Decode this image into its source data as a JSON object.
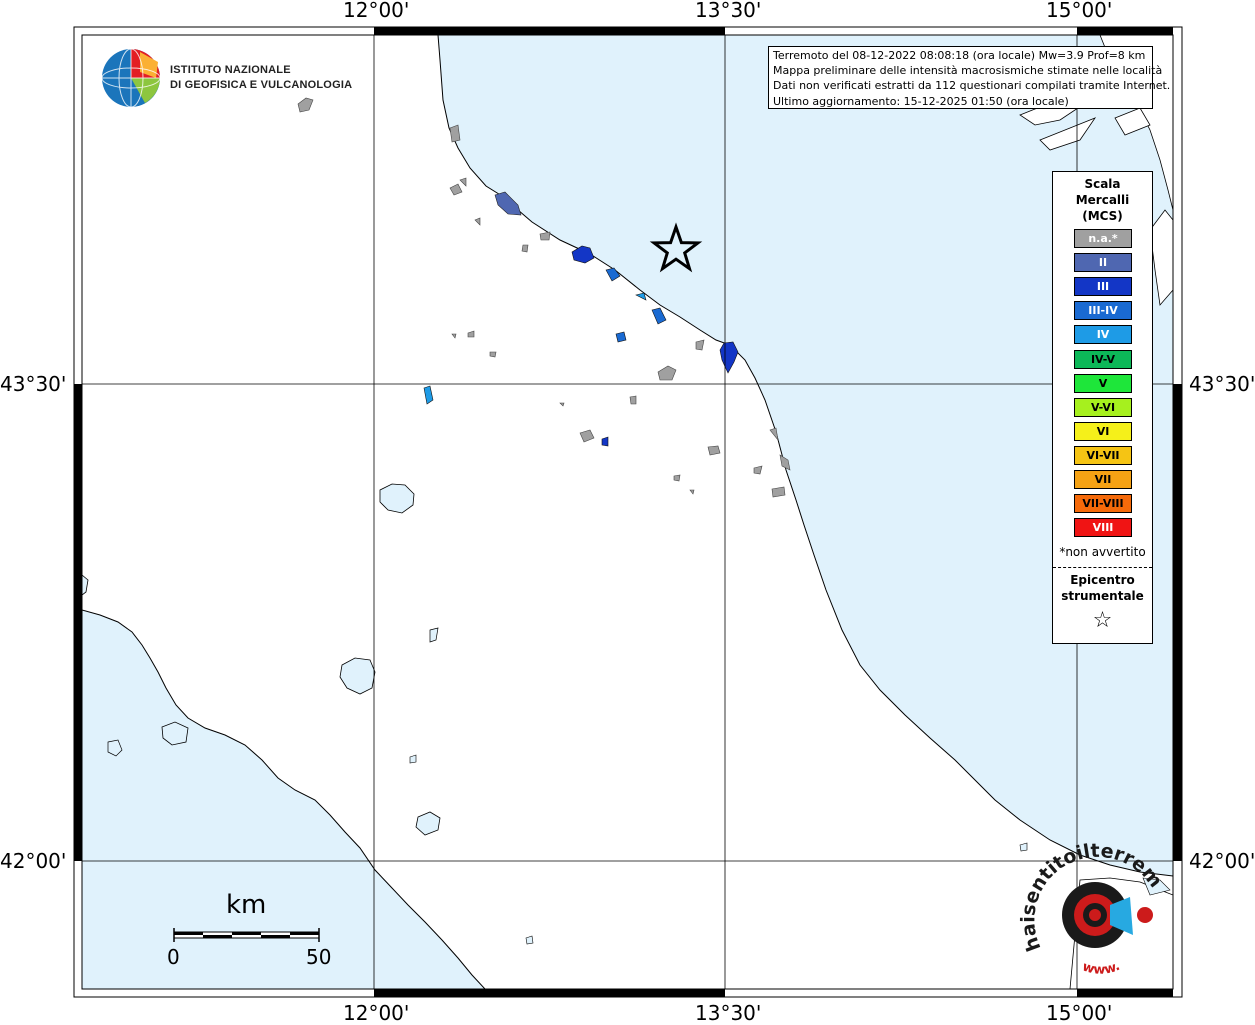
{
  "map": {
    "top_lon_labels": [
      "12°00'",
      "13°30'",
      "15°00'"
    ],
    "bottom_lon_labels": [
      "12°00'",
      "13°30'",
      "15°00'"
    ],
    "left_lat_labels": [
      "43°30'",
      "42°00'"
    ],
    "right_lat_labels": [
      "43°30'",
      "42°00'"
    ],
    "colors": {
      "sea": "#e0f2fc",
      "land": "#ffffff",
      "coast": "#000000",
      "unfelt": "#a0a0a0"
    }
  },
  "logo": {
    "line1": "ISTITUTO NAZIONALE",
    "line2": "DI GEOFISICA E VULCANOLOGIA"
  },
  "info": {
    "line1": "Terremoto del 08-12-2022 08:08:18 (ora locale) Mw=3.9 Prof=8 km",
    "line2": "Mappa preliminare delle intensità macrosismiche stimate nelle località",
    "line3": "Dati non verificati estratti da 112 questionari compilati tramite Internet.",
    "line4": "Ultimo aggiornamento: 15-12-2025 01:50 (ora locale)"
  },
  "legend": {
    "title_line1": "Scala",
    "title_line2": "Mercalli",
    "title_line3": "(MCS)",
    "items": [
      {
        "label": "n.a.*",
        "color": "#a0a0a0"
      },
      {
        "label": "II",
        "color": "#4f67b1"
      },
      {
        "label": "III",
        "color": "#1336c6"
      },
      {
        "label": "III-IV",
        "color": "#1a6ad2"
      },
      {
        "label": "IV",
        "color": "#1e9be6"
      },
      {
        "label": "IV-V",
        "color": "#0cb858"
      },
      {
        "label": "V",
        "color": "#1ee63a"
      },
      {
        "label": "V-VI",
        "color": "#a6f01e"
      },
      {
        "label": "VI",
        "color": "#f5f01a"
      },
      {
        "label": "VI-VII",
        "color": "#f5c414"
      },
      {
        "label": "VII",
        "color": "#f5a214"
      },
      {
        "label": "VII-VIII",
        "color": "#f56a0a"
      },
      {
        "label": "VIII",
        "color": "#f01414"
      }
    ],
    "note": "*non avvertito",
    "epicenter_line1": "Epicentro",
    "epicenter_line2": "strumentale",
    "epicenter_symbol": "☆"
  },
  "scale_bar": {
    "unit": "km",
    "min_label": "0",
    "max_label": "50"
  },
  "watermark": {
    "text": "haisentitoilterremoto.it",
    "url_text": "www."
  }
}
